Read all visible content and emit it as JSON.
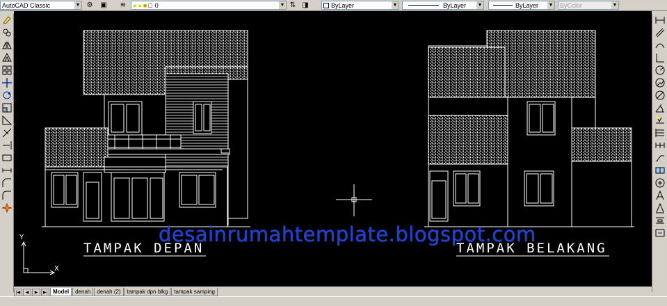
{
  "toolbar": {
    "workspace": "AutoCAD Classic",
    "layer_value": "0",
    "color_value": "ByLayer",
    "linetype_value": "ByLayer",
    "lineweight_value": "ByLayer",
    "plotstyle_value": "ByColor"
  },
  "drawing": {
    "front_label": "TAMPAK DEPAN",
    "rear_label": "TAMPAK BELAKANG",
    "watermark": "desainrumahtemplate.blogspot.com",
    "ucs_y": "Y",
    "ucs_x": "X"
  },
  "tabs": [
    "Model",
    "denah",
    "denah (2)",
    "tampak dpn blkg",
    "tampak samping"
  ],
  "active_tab": "Model",
  "colors": {
    "canvas_bg": "#000000",
    "linework": "#ffffff",
    "watermark": "#1e3fd8"
  }
}
